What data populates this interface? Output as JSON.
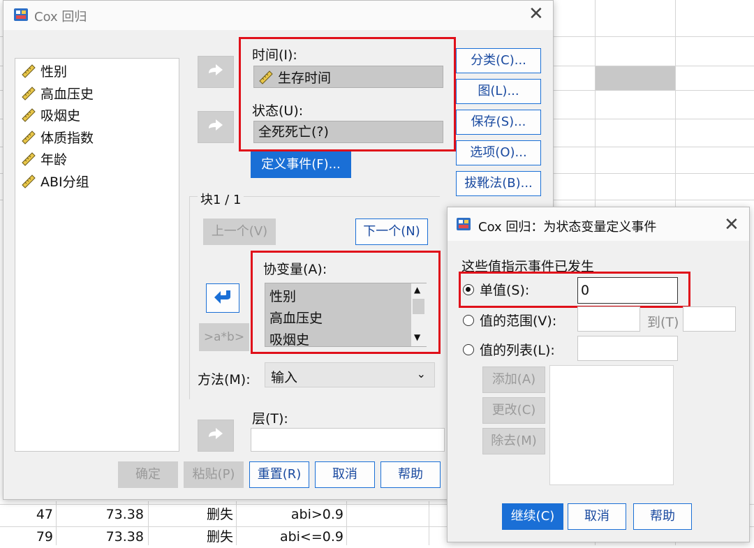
{
  "main_dialog": {
    "title": "Cox 回归",
    "variables": [
      "性别",
      "高血压史",
      "吸烟史",
      "体质指数",
      "年龄",
      "ABI分组"
    ],
    "time_label": "时间(I):",
    "time_value": "生存时间",
    "status_label": "状态(U):",
    "status_value": "全死死亡(?)",
    "define_event_button": "定义事件(F)...",
    "block_label": "块1 / 1",
    "prev_button": "上一个(V)",
    "next_button": "下一个(N)",
    "covariates_label": "协变量(A):",
    "covariates": [
      "性别",
      "高血压史",
      "吸烟史"
    ],
    "interaction_button": ">a*b>",
    "method_label": "方法(M):",
    "method_value": "输入",
    "strata_label": "层(T):",
    "right_buttons": [
      "分类(C)...",
      "图(L)...",
      "保存(S)...",
      "选项(O)...",
      "拔靴法(B)..."
    ],
    "bottom_buttons": [
      "确定",
      "粘贴(P)",
      "重置(R)",
      "取消",
      "帮助"
    ]
  },
  "event_dialog": {
    "title": "Cox 回归：为状态变量定义事件",
    "prompt": "这些值指示事件已发生",
    "single_value_label": "单值(S):",
    "single_value": "0",
    "range_label": "值的范围(V):",
    "range_to_label": "到(T)",
    "list_label": "值的列表(L):",
    "add_button": "添加(A)",
    "change_button": "更改(C)",
    "remove_button": "除去(M)",
    "continue_button": "继续(C)",
    "cancel_button": "取消",
    "help_button": "帮助"
  },
  "spreadsheet_rows": [
    [
      "47",
      "73.38",
      "删失",
      "abi>0.9"
    ],
    [
      "79",
      "73.38",
      "删失",
      "abi<=0.9"
    ]
  ],
  "colors": {
    "accent": "#1a6fd6",
    "highlight_border": "#e0101a"
  }
}
